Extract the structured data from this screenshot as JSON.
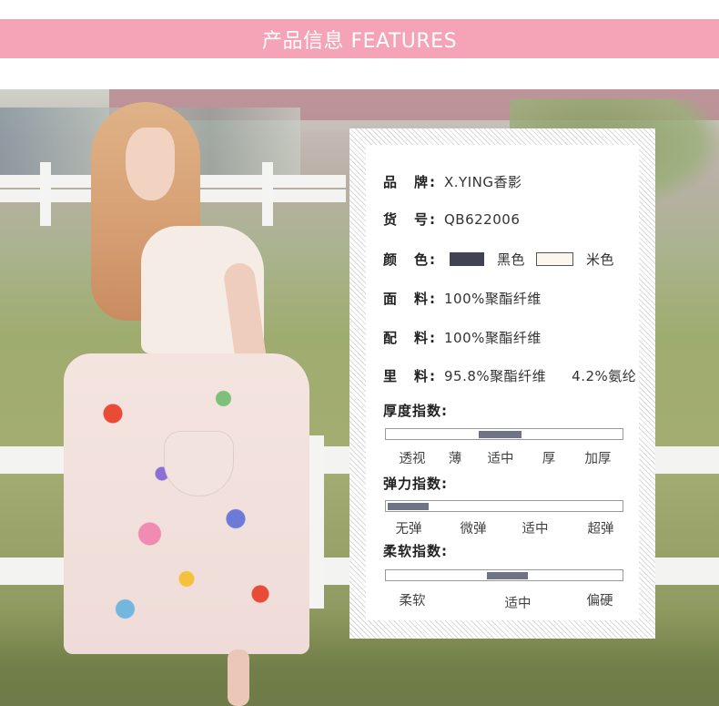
{
  "header": {
    "title": "产品信息 FEATURES"
  },
  "details": [
    {
      "label": "品　牌:",
      "value": "X.YING香影"
    },
    {
      "label": "货　号:",
      "value": "QB622006"
    },
    {
      "label": "颜　色:",
      "colors": [
        {
          "name": "黑色",
          "hex": "#3f4353"
        },
        {
          "name": "米色",
          "hex": "#fbf6ee"
        }
      ]
    },
    {
      "label": "面　料:",
      "value": "100%聚酯纤维"
    },
    {
      "label": "配　料:",
      "value": "100%聚酯纤维"
    },
    {
      "label": "里　料:",
      "value": "95.8%聚酯纤维",
      "value2": "4.2%氨纶"
    }
  ],
  "indices": [
    {
      "title": "厚度指数:",
      "options": [
        "透视",
        "薄",
        "适中",
        "厚",
        "加厚"
      ],
      "selected": "适中"
    },
    {
      "title": "弹力指数:",
      "options": [
        "无弹",
        "微弹",
        "适中",
        "超弹"
      ],
      "selected": "无弹"
    },
    {
      "title": "柔软指数:",
      "options": [
        "柔软",
        "适中",
        "偏硬"
      ],
      "selected": "适中"
    }
  ],
  "colors": {
    "banner": "#f5a3b6",
    "indicator": "#6f7386"
  }
}
